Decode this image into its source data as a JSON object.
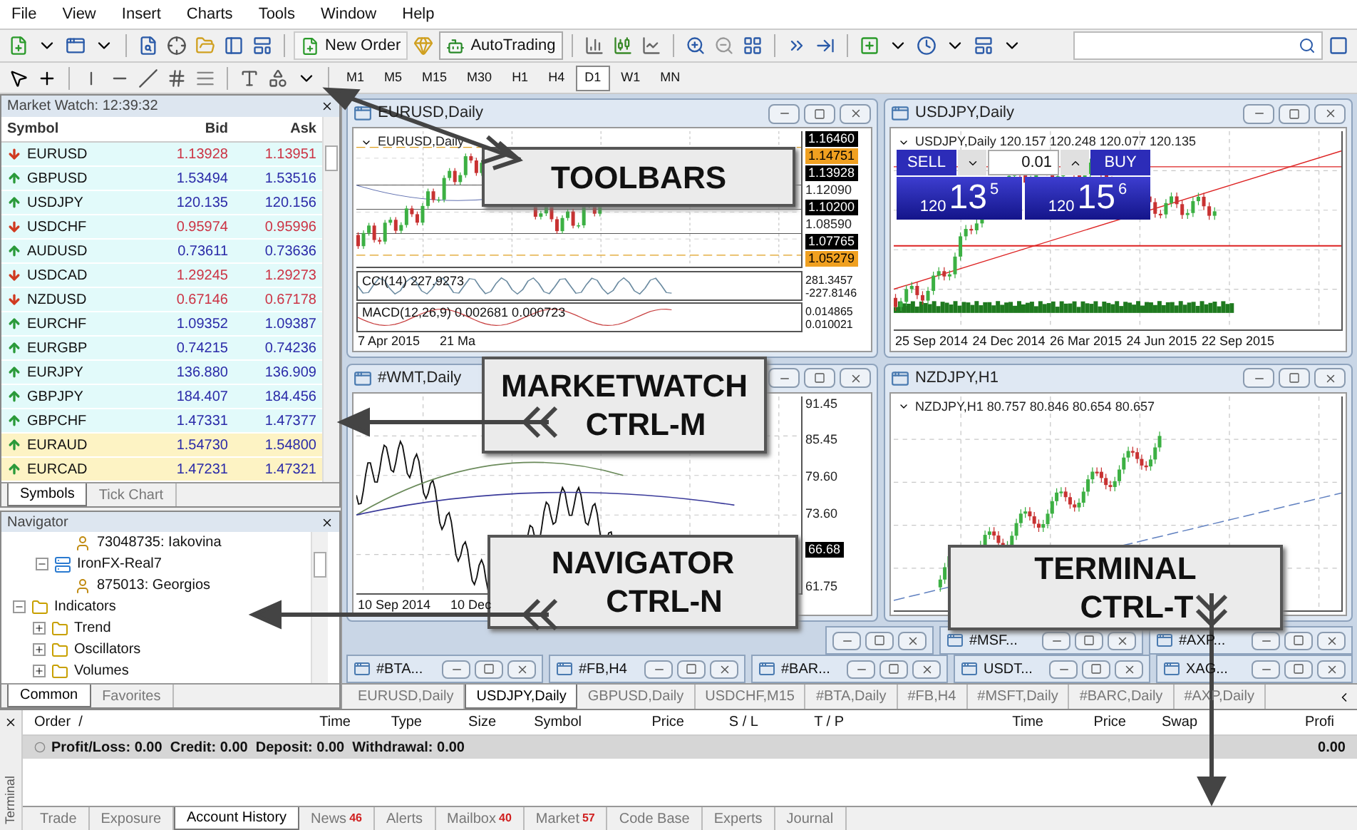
{
  "menu": [
    "File",
    "View",
    "Insert",
    "Charts",
    "Tools",
    "Window",
    "Help"
  ],
  "toolbar": {
    "new_order": "New Order",
    "autotrading": "AutoTrading"
  },
  "timeframes": [
    {
      "label": "M1",
      "selected": false
    },
    {
      "label": "M5",
      "selected": false
    },
    {
      "label": "M15",
      "selected": false
    },
    {
      "label": "M30",
      "selected": false
    },
    {
      "label": "H1",
      "selected": false
    },
    {
      "label": "H4",
      "selected": false
    },
    {
      "label": "D1",
      "selected": true
    },
    {
      "label": "W1",
      "selected": false
    },
    {
      "label": "MN",
      "selected": false
    }
  ],
  "market_watch": {
    "title": "Market Watch: 12:39:32",
    "columns": [
      "Symbol",
      "Bid",
      "Ask"
    ],
    "rows": [
      {
        "symbol": "EURUSD",
        "bid": "1.13928",
        "ask": "1.13951",
        "rising": false,
        "highlighted": false
      },
      {
        "symbol": "GBPUSD",
        "bid": "1.53494",
        "ask": "1.53516",
        "rising": true,
        "highlighted": false
      },
      {
        "symbol": "USDJPY",
        "bid": "120.135",
        "ask": "120.156",
        "rising": true,
        "highlighted": false
      },
      {
        "symbol": "USDCHF",
        "bid": "0.95974",
        "ask": "0.95996",
        "rising": false,
        "highlighted": false
      },
      {
        "symbol": "AUDUSD",
        "bid": "0.73611",
        "ask": "0.73636",
        "rising": true,
        "highlighted": false
      },
      {
        "symbol": "USDCAD",
        "bid": "1.29245",
        "ask": "1.29273",
        "rising": false,
        "highlighted": false
      },
      {
        "symbol": "NZDUSD",
        "bid": "0.67146",
        "ask": "0.67178",
        "rising": false,
        "highlighted": false
      },
      {
        "symbol": "EURCHF",
        "bid": "1.09352",
        "ask": "1.09387",
        "rising": true,
        "highlighted": false
      },
      {
        "symbol": "EURGBP",
        "bid": "0.74215",
        "ask": "0.74236",
        "rising": true,
        "highlighted": false
      },
      {
        "symbol": "EURJPY",
        "bid": "136.880",
        "ask": "136.909",
        "rising": true,
        "highlighted": false
      },
      {
        "symbol": "GBPJPY",
        "bid": "184.407",
        "ask": "184.456",
        "rising": true,
        "highlighted": false
      },
      {
        "symbol": "GBPCHF",
        "bid": "1.47331",
        "ask": "1.47377",
        "rising": true,
        "highlighted": false
      },
      {
        "symbol": "EURAUD",
        "bid": "1.54730",
        "ask": "1.54800",
        "rising": true,
        "highlighted": true
      },
      {
        "symbol": "EURCAD",
        "bid": "1.47231",
        "ask": "1.47321",
        "rising": true,
        "highlighted": true
      }
    ],
    "tabs": [
      {
        "label": "Symbols",
        "selected": true
      },
      {
        "label": "Tick Chart",
        "selected": false
      }
    ]
  },
  "navigator": {
    "title": "Navigator",
    "items": [
      {
        "label": "73048735: Iakovina",
        "kind": "account"
      },
      {
        "label": "IronFX-Real7",
        "kind": "server",
        "expanded": true,
        "children": [
          {
            "label": "875013: Georgios",
            "kind": "account"
          }
        ]
      },
      {
        "label": "Indicators",
        "kind": "folder",
        "expanded": true,
        "children": [
          {
            "label": "Trend",
            "kind": "folder",
            "expanded": false
          },
          {
            "label": "Oscillators",
            "kind": "folder",
            "expanded": false
          },
          {
            "label": "Volumes",
            "kind": "folder",
            "expanded": false
          }
        ]
      }
    ],
    "tabs": [
      {
        "label": "Common",
        "selected": true
      },
      {
        "label": "Favorites",
        "selected": false
      }
    ]
  },
  "charts": [
    {
      "title": "EURUSD,Daily",
      "kind": "candles",
      "header": "EURUSD,Daily",
      "price_labels": [
        {
          "text": "1.16460",
          "kind": "line"
        },
        {
          "text": "1.14751",
          "kind": "alert"
        },
        {
          "text": "1.13928",
          "kind": "line"
        },
        {
          "text": "1.12090",
          "kind": "plain"
        },
        {
          "text": "1.10200",
          "kind": "line"
        },
        {
          "text": "1.08590",
          "kind": "plain"
        },
        {
          "text": "1.07765",
          "kind": "line"
        },
        {
          "text": "1.05279",
          "kind": "alert"
        }
      ],
      "indicators": [
        {
          "label": "CCI(14) 227.9273",
          "values": [
            "281.3457",
            "-227.8146"
          ]
        },
        {
          "label": "MACD(12,26,9) 0.002681 0.000723",
          "values": [
            "0.014865",
            "0.010021"
          ]
        }
      ],
      "dates": [
        "7 Apr 2015",
        "21 Ma"
      ]
    },
    {
      "title": "USDJPY,Daily",
      "kind": "candles",
      "header": "USDJPY,Daily  120.157 120.248 120.077 120.135",
      "trade_panel": {
        "sell": "SELL",
        "buy": "BUY",
        "lot": "0.01",
        "sell_price": [
          "120",
          "13",
          "5"
        ],
        "buy_price": [
          "120",
          "15",
          "6"
        ]
      },
      "dates": [
        "25 Sep 2014",
        "24 Dec 2014",
        "26 Mar 2015",
        "24 Jun 2015",
        "22 Sep 2015"
      ]
    },
    {
      "title": "#WMT,Daily",
      "kind": "line",
      "price_labels": [
        {
          "text": "91.45",
          "kind": "plain"
        },
        {
          "text": "85.45",
          "kind": "plain"
        },
        {
          "text": "79.60",
          "kind": "plain"
        },
        {
          "text": "73.60",
          "kind": "plain"
        },
        {
          "text": "66.68",
          "kind": "line"
        },
        {
          "text": "61.75",
          "kind": "plain"
        }
      ],
      "dates": [
        "10 Sep 2014",
        "10 Dec"
      ]
    },
    {
      "title": "NZDJPY,H1",
      "kind": "candles",
      "header": "NZDJPY,H1  80.757 80.846 80.654 80.657"
    }
  ],
  "minimized": [
    [
      {
        "kind": "buttons_only"
      },
      {
        "kind": "window",
        "title": "#MSF..."
      },
      {
        "kind": "window",
        "title": "#AXP..."
      }
    ],
    [
      {
        "kind": "window",
        "title": "#BTA..."
      },
      {
        "kind": "window",
        "title": "#FB,H4"
      },
      {
        "kind": "window",
        "title": "#BAR..."
      },
      {
        "kind": "window",
        "title": "USDT..."
      },
      {
        "kind": "window",
        "title": "XAG..."
      }
    ]
  ],
  "chart_tabs": [
    {
      "label": "EURUSD,Daily",
      "selected": false
    },
    {
      "label": "USDJPY,Daily",
      "selected": true
    },
    {
      "label": "GBPUSD,Daily",
      "selected": false
    },
    {
      "label": "USDCHF,M15",
      "selected": false
    },
    {
      "label": "#BTA,Daily",
      "selected": false
    },
    {
      "label": "#FB,H4",
      "selected": false
    },
    {
      "label": "#MSFT,Daily",
      "selected": false
    },
    {
      "label": "#BARC,Daily",
      "selected": false
    },
    {
      "label": "#AXP,Daily",
      "selected": false
    }
  ],
  "terminal": {
    "side_label": "Terminal",
    "columns": [
      "Order  /",
      "Time",
      "Type",
      "Size",
      "Symbol",
      "Price",
      "S / L",
      "T / P",
      "Time",
      "Price",
      "Swap",
      "Profi"
    ],
    "summary": "Profit/Loss: 0.00  Credit: 0.00  Deposit: 0.00  Withdrawal: 0.00",
    "summary_value": "0.00",
    "tabs": [
      {
        "label": "Trade",
        "selected": false
      },
      {
        "label": "Exposure",
        "selected": false
      },
      {
        "label": "Account History",
        "selected": true
      },
      {
        "label": "News",
        "badge": "46",
        "selected": false
      },
      {
        "label": "Alerts",
        "selected": false
      },
      {
        "label": "Mailbox",
        "badge": "40",
        "selected": false
      },
      {
        "label": "Market",
        "badge": "57",
        "selected": false
      },
      {
        "label": "Code Base",
        "selected": false
      },
      {
        "label": "Experts",
        "selected": false
      },
      {
        "label": "Journal",
        "selected": false
      }
    ]
  },
  "callouts": [
    {
      "title": "TOOLBARS"
    },
    {
      "title": "MARKETWATCH",
      "shortcut": "CTRL-M"
    },
    {
      "title": "NAVIGATOR",
      "shortcut": "CTRL-N"
    },
    {
      "title": "TERMINAL",
      "shortcut": "CTRL-T"
    }
  ]
}
